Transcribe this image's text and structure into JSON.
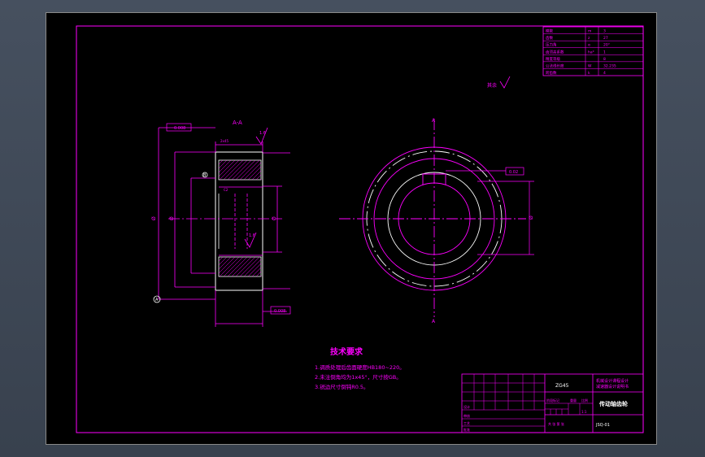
{
  "colors": {
    "line": "#ff00ff",
    "outline": "#ffffff",
    "background": "#000000",
    "viewport": "#3d4654"
  },
  "section_view": {
    "title": "A-A",
    "flatness_tolerance": "0.008",
    "bottom_tolerance": "0.008",
    "surface_finish": "1.6",
    "surface_finish_2": "1.6",
    "dim_chamfer": "2x45",
    "dim_small": "C2",
    "dim_outer": "Ø",
    "dim_mid": "Ø",
    "dim_bore": "Ø",
    "datum_label": "B",
    "datum_label_left": "A"
  },
  "front_view": {
    "section_mark_top": "A",
    "section_mark_bottom": "A",
    "keyway_tolerance": "0.02",
    "keyway_dim": "Ø"
  },
  "other_roughness": "其余",
  "tech_requirements": {
    "title": "技术要求",
    "items": [
      "1.调质处理后齿面硬度HB180~220。",
      "2.未注倒角均为1x45°，尺寸按GB。",
      "3.锐边尺寸倒钝R0.5。"
    ]
  },
  "param_table": {
    "rows": [
      {
        "name": "模数",
        "symbol": "m",
        "value": "3"
      },
      {
        "name": "齿数",
        "symbol": "z",
        "value": "27"
      },
      {
        "name": "压力角",
        "symbol": "α",
        "value": "20°"
      },
      {
        "name": "齿顶高系数",
        "symbol": "ha*",
        "value": "1"
      },
      {
        "name": "精度等级",
        "symbol": "",
        "value": "8"
      },
      {
        "name": "公法线长度",
        "symbol": "W",
        "value": "32.235"
      },
      {
        "name": "跨齿数",
        "symbol": "k",
        "value": "4"
      }
    ]
  },
  "title_block": {
    "material": "ZG45",
    "school": "机械设计课程设计",
    "school2": "减速器设计说明书",
    "part_name": "传动轴齿轮",
    "drawing_no": "JSQ-01",
    "scale": "1:1",
    "labels": {
      "design": "设计",
      "check": "审核",
      "process": "工艺",
      "approve": "批准",
      "stage": "阶段标记",
      "weight": "重量",
      "scale": "比例",
      "sheet": "共 张 第 张"
    }
  }
}
